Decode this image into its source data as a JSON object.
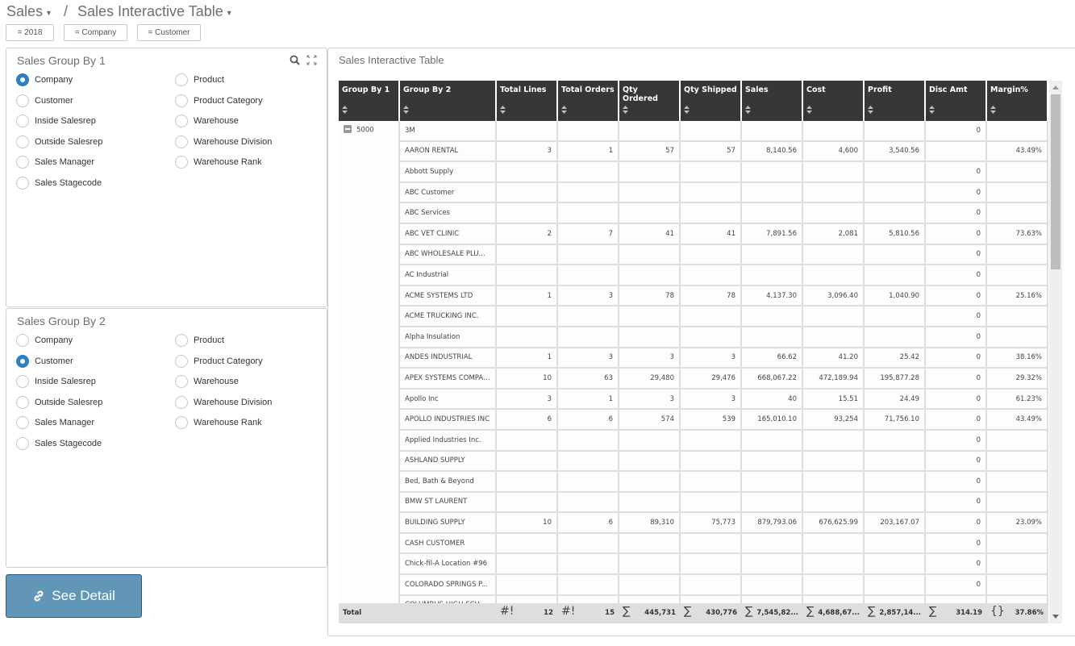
{
  "breadcrumb": {
    "root": "Sales",
    "separator": "/",
    "current": "Sales Interactive Table"
  },
  "filters": [
    "= 2018",
    "= Company",
    "= Customer"
  ],
  "group_by_1": {
    "title": "Sales Group By 1",
    "selected": "Company",
    "options_left": [
      "Company",
      "Customer",
      "Inside Salesrep",
      "Outside Salesrep",
      "Sales Manager",
      "Sales Stagecode"
    ],
    "options_right": [
      "Product",
      "Product Category",
      "Warehouse",
      "Warehouse Division",
      "Warehouse Rank"
    ]
  },
  "group_by_2": {
    "title": "Sales Group By 2",
    "selected": "Customer",
    "options_left": [
      "Company",
      "Customer",
      "Inside Salesrep",
      "Outside Salesrep",
      "Sales Manager",
      "Sales Stagecode"
    ],
    "options_right": [
      "Product",
      "Product Category",
      "Warehouse",
      "Warehouse Division",
      "Warehouse Rank"
    ]
  },
  "see_detail_label": "See Detail",
  "table": {
    "title": "Sales Interactive Table",
    "columns": [
      "Group By 1",
      "Group By 2",
      "Total Lines",
      "Total Orders",
      "Qty Ordered",
      "Qty Shipped",
      "Sales",
      "Cost",
      "Profit",
      "Disc Amt",
      "Margin%"
    ],
    "group_value": "5000",
    "rows": [
      [
        "3M",
        "",
        "",
        "",
        "",
        "",
        "",
        "",
        "0",
        ""
      ],
      [
        "AARON RENTAL",
        "3",
        "1",
        "57",
        "57",
        "8,140.56",
        "4,600",
        "3,540.56",
        "",
        "43.49%"
      ],
      [
        "Abbott Supply",
        "",
        "",
        "",
        "",
        "",
        "",
        "",
        "0",
        ""
      ],
      [
        "ABC Customer",
        "",
        "",
        "",
        "",
        "",
        "",
        "",
        "0",
        ""
      ],
      [
        "ABC Services",
        "",
        "",
        "",
        "",
        "",
        "",
        "",
        "0",
        ""
      ],
      [
        "ABC VET CLINIC",
        "2",
        "7",
        "41",
        "41",
        "7,891.56",
        "2,081",
        "5,810.56",
        "0",
        "73.63%"
      ],
      [
        "ABC WHOLESALE PLU...",
        "",
        "",
        "",
        "",
        "",
        "",
        "",
        "0",
        ""
      ],
      [
        "AC Industrial",
        "",
        "",
        "",
        "",
        "",
        "",
        "",
        "0",
        ""
      ],
      [
        "ACME SYSTEMS LTD",
        "1",
        "3",
        "78",
        "78",
        "4,137.30",
        "3,096.40",
        "1,040.90",
        "0",
        "25.16%"
      ],
      [
        "ACME TRUCKING INC.",
        "",
        "",
        "",
        "",
        "",
        "",
        "",
        "0",
        ""
      ],
      [
        "Alpha Insulation",
        "",
        "",
        "",
        "",
        "",
        "",
        "",
        "0",
        ""
      ],
      [
        "ANDES INDUSTRIAL",
        "1",
        "3",
        "3",
        "3",
        "66.62",
        "41.20",
        "25.42",
        "0",
        "38.16%"
      ],
      [
        "APEX SYSTEMS COMPANY",
        "10",
        "63",
        "29,480",
        "29,476",
        "668,067.22",
        "472,189.94",
        "195,877.28",
        "0",
        "29.32%"
      ],
      [
        "Apollo Inc",
        "3",
        "1",
        "3",
        "3",
        "40",
        "15.51",
        "24.49",
        "0",
        "61.23%"
      ],
      [
        "APOLLO INDUSTRIES INC",
        "6",
        "6",
        "574",
        "539",
        "165,010.10",
        "93,254",
        "71,756.10",
        "0",
        "43.49%"
      ],
      [
        "Applied Industries Inc.",
        "",
        "",
        "",
        "",
        "",
        "",
        "",
        "0",
        ""
      ],
      [
        "ASHLAND SUPPLY",
        "",
        "",
        "",
        "",
        "",
        "",
        "",
        "0",
        ""
      ],
      [
        "Bed, Bath & Beyond",
        "",
        "",
        "",
        "",
        "",
        "",
        "",
        "0",
        ""
      ],
      [
        "BMW ST LAURENT",
        "",
        "",
        "",
        "",
        "",
        "",
        "",
        "0",
        ""
      ],
      [
        "BUILDING SUPPLY",
        "10",
        "6",
        "89,310",
        "75,773",
        "879,793.06",
        "676,625.99",
        "203,167.07",
        "0",
        "23.09%"
      ],
      [
        "CASH CUSTOMER",
        "",
        "",
        "",
        "",
        "",
        "",
        "",
        "0",
        ""
      ],
      [
        "Chick-fil-A Location #96",
        "",
        "",
        "",
        "",
        "",
        "",
        "",
        "0",
        ""
      ],
      [
        "COLORADO SPRINGS P...",
        "",
        "",
        "",
        "",
        "",
        "",
        "",
        "0",
        ""
      ],
      [
        "COLUMBUS HIGH SCH...",
        "",
        "",
        "",
        "",
        "",
        "",
        "",
        "",
        ""
      ]
    ],
    "totals": {
      "label": "Total",
      "total_lines": {
        "agg": "#!",
        "value": "12"
      },
      "total_orders": {
        "agg": "#!",
        "value": "15"
      },
      "qty_ordered": {
        "agg": "∑",
        "value": "445,731"
      },
      "qty_shipped": {
        "agg": "∑",
        "value": "430,776"
      },
      "sales": {
        "agg": "∑",
        "value": "7,545,82..."
      },
      "cost": {
        "agg": "∑",
        "value": "4,688,67..."
      },
      "profit": {
        "agg": "∑",
        "value": "2,857,14..."
      },
      "disc_amt": {
        "agg": "∑",
        "value": "314.19"
      },
      "margin": {
        "agg": "{}",
        "value": "37.86%"
      }
    }
  },
  "colors": {
    "header_bg": "#373737",
    "radio_selected": "#2f7ec1",
    "button_bg": "#6296b7"
  }
}
